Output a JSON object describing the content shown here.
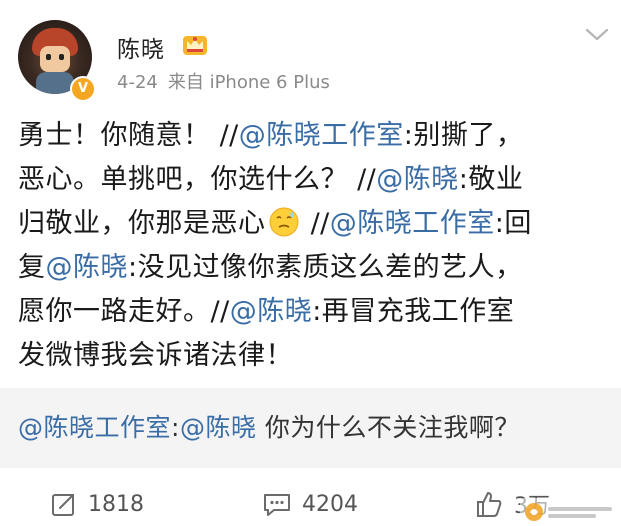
{
  "user": {
    "name": "陈晓",
    "date": "4-24",
    "source": "来自 iPhone 6 Plus",
    "verified_badge": "V",
    "avatar_icon": "avatar",
    "crown_icon": "crown-icon"
  },
  "post": {
    "line1": {
      "a": "勇士！你随意！ //",
      "m1": "@陈晓工作室",
      "b": ":别撕了，"
    },
    "line2": {
      "a": "恶心。单挑吧，你选什么？ //",
      "m1": "@陈晓",
      "b": ":敬业"
    },
    "line3": {
      "a": "归敬业，你那是恶心",
      "b": " //",
      "m1": "@陈晓工作室",
      "c": ":回"
    },
    "line4": {
      "a": "复",
      "m1": "@陈晓",
      "b": ":没见过像你素质这么差的艺人，"
    },
    "line5": {
      "a": "愿你一路走好。//",
      "m1": "@陈晓",
      "b": ":再冒充我工作室"
    },
    "line6": {
      "a": "发微博我会诉诸法律！"
    }
  },
  "quote": {
    "mention1": "@陈晓工作室",
    "sep": ":",
    "mention2": "@陈晓",
    "text": " 你为什么不关注我啊？"
  },
  "actions": {
    "repost_count": "1818",
    "comment_count": "4204",
    "like_count": "3万"
  },
  "colors": {
    "mention": "#3a6da6",
    "verified": "#f5a623",
    "quote_bg": "#f4f4f4"
  }
}
